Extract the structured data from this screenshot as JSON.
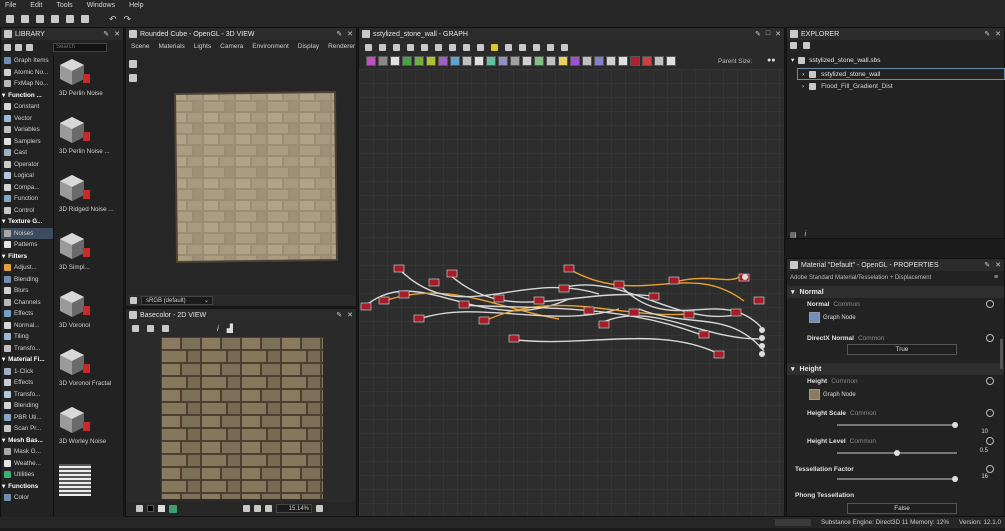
{
  "menu": [
    "File",
    "Edit",
    "Tools",
    "Windows",
    "Help"
  ],
  "library": {
    "title": "LIBRARY",
    "search_placeholder": "Search",
    "tree": [
      {
        "label": "Graph Items",
        "type": "item"
      },
      {
        "label": "Atomic No...",
        "type": "item"
      },
      {
        "label": "FxMap No...",
        "type": "item"
      },
      {
        "label": "Function ...",
        "type": "header"
      },
      {
        "label": "Constant",
        "type": "item"
      },
      {
        "label": "Vector",
        "type": "item"
      },
      {
        "label": "Variables",
        "type": "item"
      },
      {
        "label": "Samplers",
        "type": "item"
      },
      {
        "label": "Cast",
        "type": "item"
      },
      {
        "label": "Operator",
        "type": "item"
      },
      {
        "label": "Logical",
        "type": "item"
      },
      {
        "label": "Compa...",
        "type": "item"
      },
      {
        "label": "Function",
        "type": "item"
      },
      {
        "label": "Control",
        "type": "item"
      },
      {
        "label": "Texture G...",
        "type": "header"
      },
      {
        "label": "Noises",
        "type": "selected"
      },
      {
        "label": "Patterns",
        "type": "item"
      },
      {
        "label": "Filters",
        "type": "header"
      },
      {
        "label": "Adjust...",
        "type": "item"
      },
      {
        "label": "Blending",
        "type": "item"
      },
      {
        "label": "Blurs",
        "type": "item"
      },
      {
        "label": "Channels",
        "type": "item"
      },
      {
        "label": "Effects",
        "type": "item"
      },
      {
        "label": "Normal...",
        "type": "item"
      },
      {
        "label": "Tiling",
        "type": "item"
      },
      {
        "label": "Transfo...",
        "type": "item"
      },
      {
        "label": "Material Fi...",
        "type": "header"
      },
      {
        "label": "1-Click",
        "type": "item"
      },
      {
        "label": "Effects",
        "type": "item"
      },
      {
        "label": "Transfo...",
        "type": "item"
      },
      {
        "label": "Blending",
        "type": "item"
      },
      {
        "label": "PBR Uti...",
        "type": "item"
      },
      {
        "label": "Scan Pr...",
        "type": "item"
      },
      {
        "label": "Mesh Bas...",
        "type": "header"
      },
      {
        "label": "Mask G...",
        "type": "item"
      },
      {
        "label": "Weathe...",
        "type": "item"
      },
      {
        "label": "Utilities",
        "type": "item"
      },
      {
        "label": "Functions",
        "type": "header"
      },
      {
        "label": "Color",
        "type": "item"
      }
    ],
    "thumbnails": [
      {
        "label": "3D Perlin Noise"
      },
      {
        "label": "3D Perlin Noise ..."
      },
      {
        "label": "3D Ridged Noise ..."
      },
      {
        "label": "3D Simpl..."
      },
      {
        "label": "3D Voronoi"
      },
      {
        "label": "3D Voronoi Fractal"
      },
      {
        "label": "3D Worley Noise"
      }
    ]
  },
  "view3d": {
    "title": "Rounded Cube - OpenGL - 3D VIEW",
    "tabs": [
      "Scene",
      "Materials",
      "Lights",
      "Camera",
      "Environment",
      "Display",
      "Renderer"
    ],
    "colorspace": "sRGB (default)"
  },
  "view2d": {
    "title": "Basecolor - 2D VIEW",
    "zoom": "15.14%"
  },
  "graph": {
    "title": "sstylized_stone_wall - GRAPH",
    "parent_size_label": "Parent Size:"
  },
  "explorer": {
    "title": "EXPLORER",
    "package": "sstylized_stone_wall.sbs",
    "items": [
      "sstylized_stone_wall",
      "Flood_Fill_Gradient_Dist"
    ]
  },
  "properties": {
    "title": "Material \"Default\" - OpenGL - PROPERTIES",
    "subtitle": "Adobe Standard Material/Tesselation + Displacement",
    "sections": {
      "normal": "Normal",
      "height": "Height"
    },
    "normal_param": {
      "label": "Normal",
      "tag": "Common",
      "node": "Graph Node"
    },
    "directx_param": {
      "label": "DirectX Normal",
      "tag": "Common",
      "value": "True"
    },
    "height_param": {
      "label": "Height",
      "tag": "Common",
      "node": "Graph Node"
    },
    "height_scale": {
      "label": "Height Scale",
      "tag": "Common",
      "value": "10",
      "fraction": 0.98
    },
    "height_level": {
      "label": "Height Level",
      "tag": "Common",
      "value": "0.5",
      "fraction": 0.5
    },
    "tess_factor": {
      "label": "Tessellation Factor",
      "value": "16",
      "fraction": 0.98
    },
    "phong": {
      "label": "Phong Tessellation",
      "value": "False"
    }
  },
  "status": {
    "engine": "Substance Engine: Direct3D 11  Memory: 12%",
    "version": "Version: 12.1.0"
  },
  "colors": {
    "accent": "#3d4c5e",
    "node": "#a51c2a",
    "wire": "#d8d8d8",
    "wire_orange": "#e8a030"
  }
}
